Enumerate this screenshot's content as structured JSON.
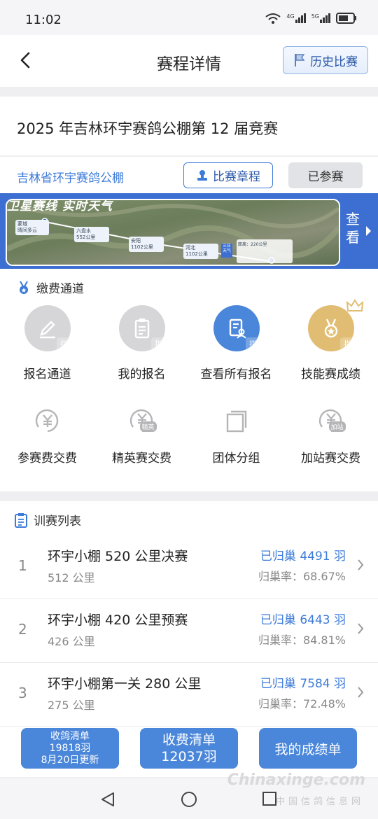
{
  "status": {
    "time": "11:02",
    "sig1": "4G",
    "sig2": "5G"
  },
  "nav": {
    "title": "赛程详情",
    "history_label": "历史比赛"
  },
  "race": {
    "title": "2025 年吉林环宇赛鸽公棚第 12 届竞赛"
  },
  "club": {
    "name": "吉林省环宇赛鸽公棚",
    "rules_label": "比赛章程",
    "joined_label": "已参赛"
  },
  "banner": {
    "slogan": "卫星赛线 实时天气",
    "link_label": "查看",
    "stations": [
      {
        "name": "蒙城",
        "sub": "晴间多云"
      },
      {
        "name": "六盘水",
        "sub": "552公里"
      },
      {
        "name": "安阳",
        "sub": "1102公里"
      },
      {
        "name": "河北",
        "sub": "1102公里"
      }
    ],
    "weather_tag": "三日天气",
    "distance_tag": "距离：220公里"
  },
  "fee": {
    "heading": "缴费通道",
    "badge": "指",
    "row1": [
      {
        "label": "报名通道"
      },
      {
        "label": "我的报名"
      },
      {
        "label": "查看所有报名"
      },
      {
        "label": "技能赛成绩"
      }
    ],
    "row2": [
      {
        "label": "参赛费交费",
        "tag": ""
      },
      {
        "label": "精英赛交费",
        "tag": "精英"
      },
      {
        "label": "团体分组",
        "tag": ""
      },
      {
        "label": "加站赛交费",
        "tag": "加站"
      }
    ]
  },
  "training": {
    "heading": "训赛列表",
    "rows": [
      {
        "num": "1",
        "name": "环宇小棚 520 公里决赛",
        "dist": "512 公里",
        "home": "已归巢 4491 羽",
        "rate": "归巢率：68.67%"
      },
      {
        "num": "2",
        "name": "环宇小棚 420 公里预赛",
        "dist": "426 公里",
        "home": "已归巢 6443 羽",
        "rate": "归巢率：84.81%"
      },
      {
        "num": "3",
        "name": "环宇小棚第一关 280 公里",
        "dist": "275 公里",
        "home": "已归巢 7584 羽",
        "rate": "归巢率：72.48%"
      }
    ]
  },
  "bottom": {
    "collect": {
      "line1": "收鸽清单",
      "line2": "19818羽",
      "line3": "8月20日更新"
    },
    "charge": {
      "line1": "收费清单",
      "line2": "12037羽"
    },
    "mine": {
      "label": "我的成绩单"
    }
  },
  "watermark": {
    "text": "Chinaxinge.com",
    "sub": "中国信鸽信息网"
  },
  "colors": {
    "accent": "#3c7bd8",
    "banner": "#3c6fd1",
    "gold": "#e0bd72",
    "grey_icon": "#d6d6d8"
  }
}
